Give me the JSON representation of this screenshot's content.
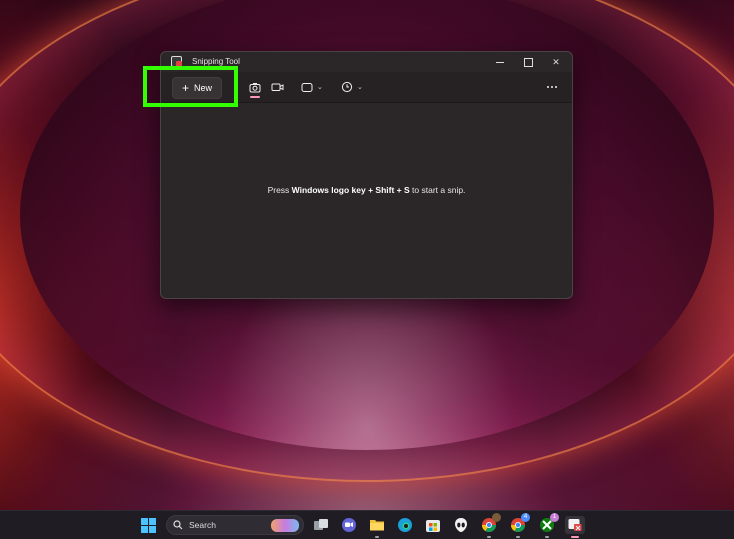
{
  "window": {
    "title": "Snipping Tool",
    "new_button_label": "New",
    "message_prefix": "Press ",
    "message_key1": "Windows logo key",
    "message_plus1": " + ",
    "message_key2": "Shift",
    "message_plus2": " + ",
    "message_key3": "S",
    "message_suffix": " to start a snip."
  },
  "toolbar": {
    "modes": [
      "screenshot-icon",
      "video-icon"
    ],
    "shape_icon": "rectangle-icon",
    "timer_icon": "clock-icon"
  },
  "taskbar": {
    "search_label": "Search",
    "badges": {
      "chrome_2": "4",
      "xbox": "1"
    }
  },
  "colors": {
    "highlight": "#33ff00",
    "window_bg": "#2b2628",
    "accent": "#ff9ab6"
  }
}
